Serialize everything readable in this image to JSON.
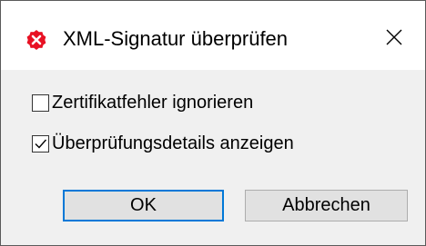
{
  "dialog": {
    "title": "XML-Signatur überprüfen",
    "app_icon": "error-x-icon",
    "close_icon": "close-icon"
  },
  "options": [
    {
      "label": "Zertifikatfehler ignorieren",
      "checked": false
    },
    {
      "label": "Überprüfungsdetails anzeigen",
      "checked": true
    }
  ],
  "buttons": {
    "ok_label": "OK",
    "cancel_label": "Abbrechen"
  },
  "colors": {
    "app_icon_red": "#e81123",
    "default_button_border": "#0078d7",
    "dialog_body_background": "#f0f0f0",
    "button_background": "#e1e1e1"
  }
}
